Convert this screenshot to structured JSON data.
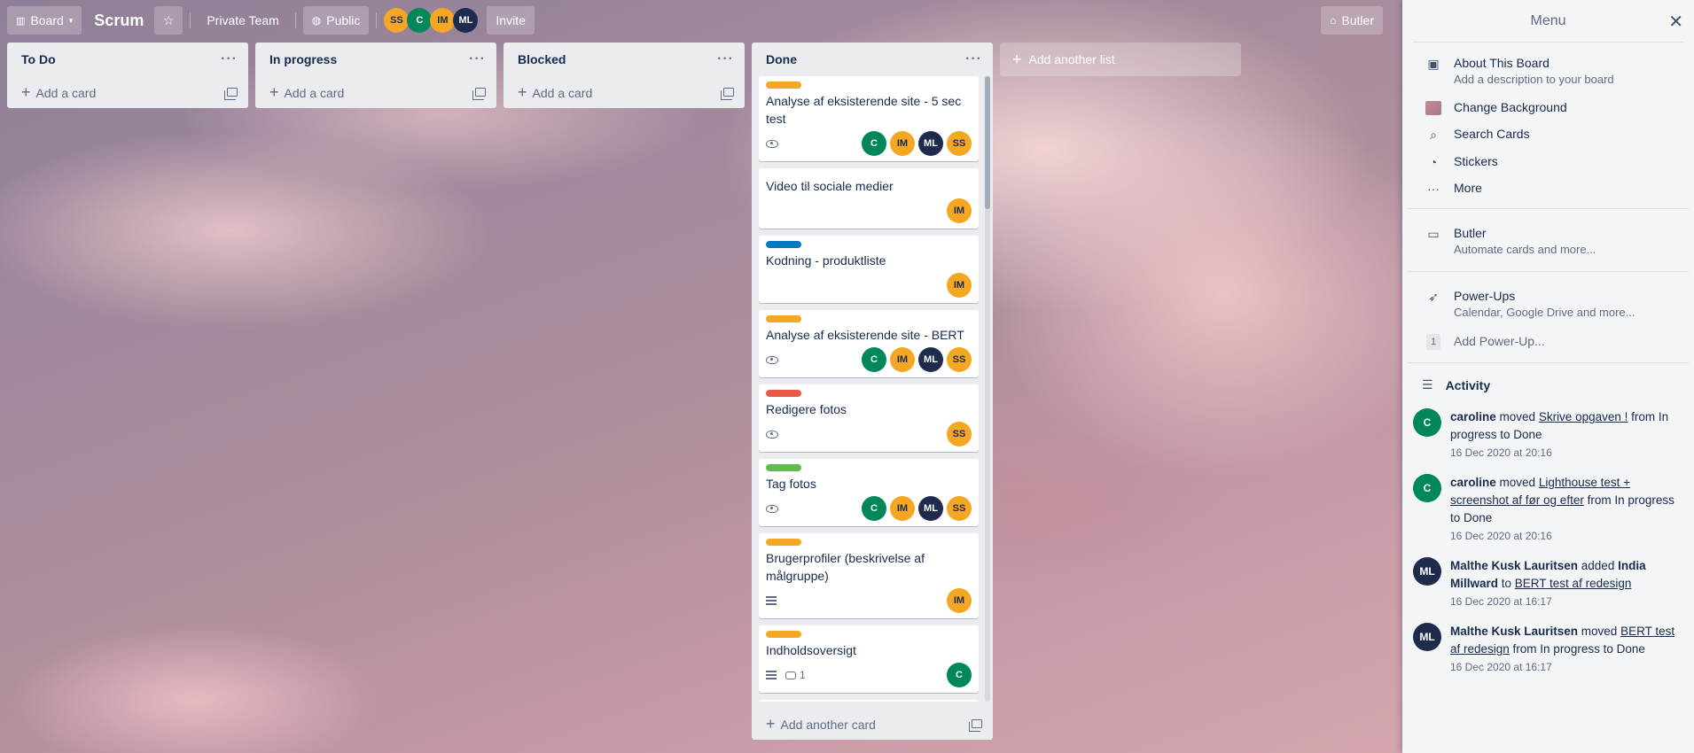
{
  "header": {
    "board_switch_label": "Board",
    "board_title": "Scrum",
    "team_label": "Private Team",
    "visibility_label": "Public",
    "members": [
      "SS",
      "C",
      "IM",
      "ML"
    ],
    "invite_label": "Invite",
    "butler_label": "Butler"
  },
  "lists": [
    {
      "title": "To Do",
      "add_label": "Add a card"
    },
    {
      "title": "In progress",
      "add_label": "Add a card"
    },
    {
      "title": "Blocked",
      "add_label": "Add a card"
    }
  ],
  "done": {
    "title": "Done",
    "add_label": "Add another card",
    "cards": [
      {
        "label_color": "#f5a623",
        "title": "Analyse af eksisterende site - 5 sec test",
        "watch": true,
        "members": [
          "C",
          "IM",
          "ML",
          "SS"
        ]
      },
      {
        "label_color": "",
        "title": "Video til sociale medier",
        "watch": false,
        "members": [
          "IM"
        ]
      },
      {
        "label_color": "#0079bf",
        "title": "Kodning - produktliste",
        "watch": false,
        "members": [
          "IM"
        ]
      },
      {
        "label_color": "#f5a623",
        "title": "Analyse af eksisterende site - BERT",
        "watch": true,
        "members": [
          "C",
          "IM",
          "ML",
          "SS"
        ]
      },
      {
        "label_color": "#eb5a46",
        "title": "Redigere fotos",
        "watch": true,
        "members": [
          "SS"
        ]
      },
      {
        "label_color": "#61bd4f",
        "title": "Tag fotos",
        "watch": true,
        "members": [
          "C",
          "IM",
          "ML",
          "SS"
        ]
      },
      {
        "label_color": "#f5a623",
        "title": "Brugerprofiler (beskrivelse af målgruppe)",
        "desc": true,
        "members": [
          "IM"
        ]
      },
      {
        "label_color": "#f5a623",
        "title": "Indholdsoversigt",
        "desc": true,
        "comments": "1",
        "members": [
          "C"
        ]
      }
    ]
  },
  "add_list_label": "Add another list",
  "menu": {
    "title": "Menu",
    "items": [
      {
        "title": "About This Board",
        "sub": "Add a description to your board"
      },
      {
        "title": "Change Background"
      },
      {
        "title": "Search Cards"
      },
      {
        "title": "Stickers"
      },
      {
        "title": "More"
      }
    ],
    "butler": {
      "title": "Butler",
      "sub": "Automate cards and more..."
    },
    "powerups": {
      "title": "Power-Ups",
      "sub": "Calendar, Google Drive and more...",
      "count": "1",
      "add_label": "Add Power-Up..."
    },
    "activity_title": "Activity",
    "activity": [
      {
        "avatar": "C",
        "user": "caroline",
        "pre": "moved",
        "link": "Skrive opgaven !",
        "post": "from In progress to Done",
        "time": "16 Dec 2020 at 20:16"
      },
      {
        "avatar": "C",
        "user": "caroline",
        "pre": "moved",
        "link": "Lighthouse test + screenshot af før og efter",
        "post": "from In progress to Done",
        "time": "16 Dec 2020 at 20:16"
      },
      {
        "avatar": "ML",
        "user": "Malthe Kusk Lauritsen",
        "pre": "added",
        "target": "India Millward",
        "mid": "to",
        "link": "BERT test af redesign",
        "post": "",
        "time": "16 Dec 2020 at 16:17"
      },
      {
        "avatar": "ML",
        "user": "Malthe Kusk Lauritsen",
        "pre": "moved",
        "link": "BERT test af redesign",
        "post": "from In progress to Done",
        "time": "16 Dec 2020 at 16:17"
      }
    ]
  },
  "colors": {
    "avatar_orange": "#f5a623",
    "avatar_green": "#00875a",
    "avatar_navy": "#1f2b4d",
    "list_bg": "#ebecf0"
  }
}
